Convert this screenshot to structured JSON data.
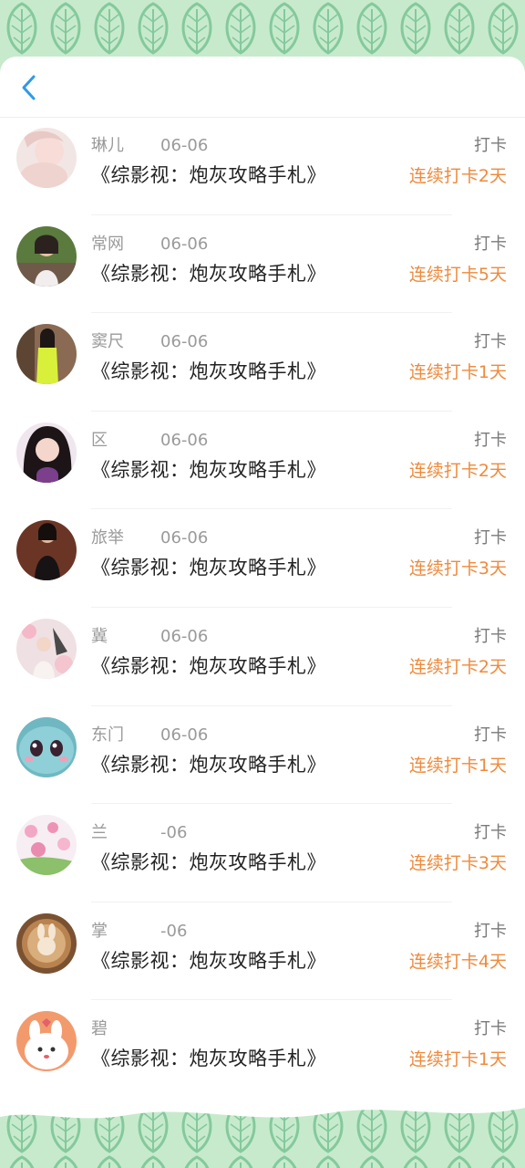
{
  "colors": {
    "banner_bg": "#c7eacd",
    "leaf_stroke": "#84c99c",
    "accent_back": "#2f9ae8",
    "streak_orange": "#ef8a3c"
  },
  "header": {
    "back_icon": "chevron-left-icon"
  },
  "entries": [
    {
      "name": "琳儿",
      "date": "06-06",
      "title": "《综影视：炮灰攻略手札》",
      "action": "打卡",
      "streak": "连续打卡2天",
      "avatar": "pale-portrait"
    },
    {
      "name": "常网",
      "date": "06-06",
      "title": "《综影视：炮灰攻略手札》",
      "action": "打卡",
      "streak": "连续打卡5天",
      "avatar": "child-outdoor"
    },
    {
      "name": "窦尺",
      "date": "06-06",
      "title": "《综影视：炮灰攻略手札》",
      "action": "打卡",
      "streak": "连续打卡1天",
      "avatar": "girl-yellow-dress"
    },
    {
      "name": "区",
      "date": "06-06",
      "title": "《综影视：炮灰攻略手札》",
      "action": "打卡",
      "streak": "连续打卡2天",
      "avatar": "girl-selfie"
    },
    {
      "name": "旅举",
      "date": "06-06",
      "title": "《综影视：炮灰攻略手札》",
      "action": "打卡",
      "streak": "连续打卡3天",
      "avatar": "woman-black-dress"
    },
    {
      "name": "冀",
      "date": "06-06",
      "title": "《综影视：炮灰攻略手札》",
      "action": "打卡",
      "streak": "连续打卡2天",
      "avatar": "girl-pink-flowers"
    },
    {
      "name": "东门",
      "date": "06-06",
      "title": "《综影视：炮灰攻略手札》",
      "action": "打卡",
      "streak": "连续打卡1天",
      "avatar": "cartoon-squirtle"
    },
    {
      "name": "兰",
      "date": "-06",
      "title": "《综影视：炮灰攻略手札》",
      "action": "打卡",
      "streak": "连续打卡3天",
      "avatar": "pink-flowers"
    },
    {
      "name": "掌",
      "date": "-06",
      "title": "《综影视：炮灰攻略手札》",
      "action": "打卡",
      "streak": "连续打卡4天",
      "avatar": "latte-art-bunny"
    },
    {
      "name": "碧",
      "date": "",
      "title": "《综影视：炮灰攻略手札》",
      "action": "打卡",
      "streak": "连续打卡1天",
      "avatar": "cartoon-bunny"
    }
  ]
}
